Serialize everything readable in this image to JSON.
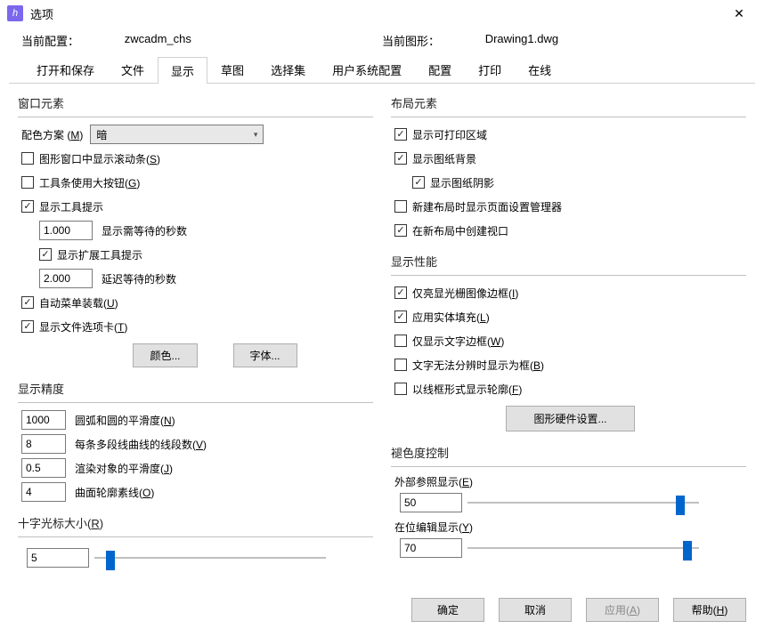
{
  "window": {
    "title": "选项"
  },
  "info": {
    "config_label": "当前配置：",
    "config_value": "zwcadm_chs",
    "drawing_label": "当前图形：",
    "drawing_value": "Drawing1.dwg"
  },
  "tabs": [
    "打开和保存",
    "文件",
    "显示",
    "草图",
    "选择集",
    "用户系统配置",
    "配置",
    "打印",
    "在线"
  ],
  "active_tab": "显示",
  "window_elements": {
    "title": "窗口元素",
    "color_scheme_label": "配色方案 (M)",
    "color_scheme_value": "暗",
    "scrollbar": "图形窗口中显示滚动条(S)",
    "big_buttons": "工具条使用大按钮(G)",
    "tooltips": "显示工具提示",
    "tooltip_delay_value": "1.000",
    "tooltip_delay_label": "显示需等待的秒数",
    "ext_tooltips": "显示扩展工具提示",
    "ext_delay_value": "2.000",
    "ext_delay_label": "延迟等待的秒数",
    "auto_menu": "自动菜单装载(U)",
    "file_tabs": "显示文件选项卡(T)",
    "color_btn": "颜色...",
    "font_btn": "字体..."
  },
  "precision": {
    "title": "显示精度",
    "arc_value": "1000",
    "arc_label": "圆弧和圆的平滑度(N)",
    "poly_value": "8",
    "poly_label": "每条多段线曲线的线段数(V)",
    "render_value": "0.5",
    "render_label": "渲染对象的平滑度(J)",
    "contour_value": "4",
    "contour_label": "曲面轮廓素线(O)"
  },
  "crosshair": {
    "title": "十字光标大小(R)",
    "value": "5",
    "pct": 5
  },
  "layout": {
    "title": "布局元素",
    "printable": "显示可打印区域",
    "paper_bg": "显示图纸背景",
    "shadow": "显示图纸阴影",
    "page_setup": "新建布局时显示页面设置管理器",
    "viewport": "在新布局中创建视口"
  },
  "performance": {
    "title": "显示性能",
    "raster": "仅亮显光栅图像边框(I)",
    "fill": "应用实体填充(L)",
    "text_frame": "仅显示文字边框(W)",
    "text_box": "文字无法分辨时显示为框(B)",
    "wire": "以线框形式显示轮廓(F)",
    "hw_btn": "图形硬件设置..."
  },
  "fade": {
    "title": "褪色度控制",
    "xref_label": "外部参照显示(E)",
    "xref_value": "50",
    "xref_pct": 90,
    "inplace_label": "在位编辑显示(Y)",
    "inplace_value": "70",
    "inplace_pct": 93
  },
  "buttons": {
    "ok": "确定",
    "cancel": "取消",
    "apply": "应用(A)",
    "help": "帮助(H)"
  }
}
